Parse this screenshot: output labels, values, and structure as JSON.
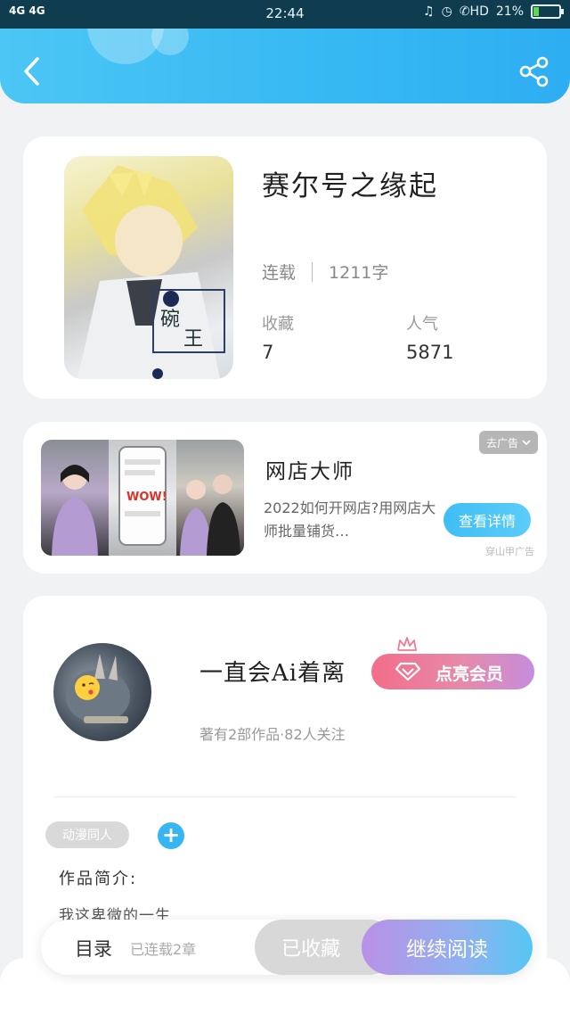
{
  "status_bar": {
    "network": "4G 4G",
    "time": "22:44",
    "icons": [
      "mute-bell-icon",
      "alarm-icon",
      "hd-call-icon"
    ],
    "battery_text": "21%",
    "battery_level": 0.21
  },
  "header": {
    "back_icon": "chevron-left-icon",
    "share_icon": "share-icon"
  },
  "book": {
    "title": "赛尔号之缘起",
    "status": "连载",
    "word_count": "1211字",
    "favorites_label": "收藏",
    "favorites_value": "7",
    "popularity_label": "人气",
    "popularity_value": "5871"
  },
  "ad": {
    "close_label": "去广告",
    "title": "网店大师",
    "description": "2022如何开网店?用网店大师批量铺货…",
    "button_label": "查看详情",
    "source": "穿山甲广告",
    "image_badge": "WOW!"
  },
  "author": {
    "name": "一直会Ai着离",
    "meta": "著有2部作品·82人关注",
    "vip_label": "点亮会员",
    "tag": "动漫同人",
    "add_tag_symbol": "+",
    "intro_label": "作品简介:",
    "intro_text": "我这卑微的一生"
  },
  "bottom_bar": {
    "toc_label": "目录",
    "chapters_label": "已连载2章",
    "favorite_label": "已收藏",
    "read_label": "继续阅读"
  },
  "colors": {
    "header": "#36b8f3",
    "accent_blue": "#35b6f2",
    "vip_pink": "#f36d8a",
    "read_purple": "#b991e6"
  }
}
